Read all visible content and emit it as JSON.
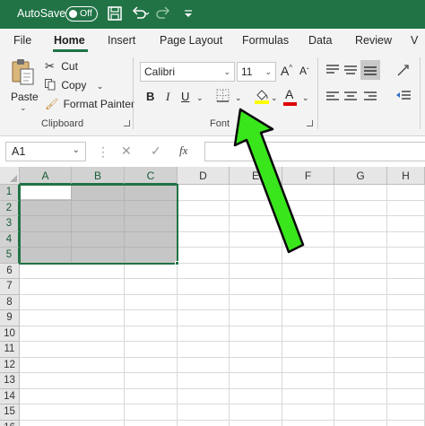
{
  "titlebar": {
    "autosave_label": "AutoSave",
    "autosave_state": "Off",
    "icons": [
      "save-icon",
      "undo-icon",
      "redo-icon",
      "customize-qat-icon"
    ]
  },
  "tabs": [
    {
      "label": "File",
      "active": false
    },
    {
      "label": "Home",
      "active": true
    },
    {
      "label": "Insert",
      "active": false
    },
    {
      "label": "Page Layout",
      "active": false
    },
    {
      "label": "Formulas",
      "active": false
    },
    {
      "label": "Data",
      "active": false
    },
    {
      "label": "Review",
      "active": false
    },
    {
      "label": "V",
      "active": false
    }
  ],
  "clipboard": {
    "paste_label": "Paste",
    "cut_label": "Cut",
    "copy_label": "Copy",
    "format_painter_label": "Format Painter",
    "group_label": "Clipboard"
  },
  "font": {
    "font_name": "Calibri",
    "font_size": "11",
    "bold": "B",
    "italic": "I",
    "underline": "U",
    "grow_label": "A",
    "shrink_label": "A",
    "font_color_label": "A",
    "group_label": "Font"
  },
  "formula_bar": {
    "name_box_value": "A1",
    "formula_value": ""
  },
  "grid": {
    "columns": [
      "A",
      "B",
      "C",
      "D",
      "E",
      "F",
      "G",
      "H"
    ],
    "rows": [
      "1",
      "2",
      "3",
      "4",
      "5",
      "6",
      "7",
      "8",
      "9",
      "10",
      "11",
      "12",
      "13",
      "14",
      "15",
      "16"
    ],
    "selected_range": "A1:C5"
  },
  "colors": {
    "brand": "#217346",
    "arrow": "#39e61c",
    "highlight_yellow": "#ffff00",
    "font_red": "#e00000"
  }
}
